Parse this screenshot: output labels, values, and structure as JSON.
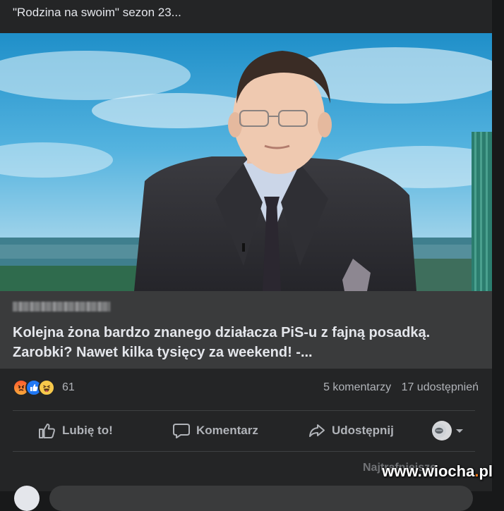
{
  "post": {
    "text": "\"Rodzina na swoim\" sezon 23..."
  },
  "link": {
    "domain_redacted": "",
    "title": "Kolejna żona bardzo znanego działacza PiS-u z fajną posadką. Zarobki? Nawet kilka tysięcy za weekend! -...",
    "info_symbol": "i"
  },
  "reactions": {
    "icons": [
      "angry-react-icon",
      "like-react-icon",
      "haha-react-icon"
    ],
    "count": "61"
  },
  "stats": {
    "comments": "5 komentarzy",
    "shares": "17 udostępnień"
  },
  "actions": {
    "like": "Lubię to!",
    "comment": "Komentarz",
    "share": "Udostępnij"
  },
  "comments_sort": {
    "label": "Najtrafniejsze"
  },
  "watermark": {
    "text_before_dot": "www.wiocha",
    "dot": ".",
    "text_after_dot": "pl"
  },
  "colors": {
    "background": "#18191a",
    "card": "#242526",
    "preview": "#3a3b3c",
    "text_primary": "#e4e6eb",
    "text_secondary": "#b0b3b8",
    "like_blue": "#2078f4"
  }
}
